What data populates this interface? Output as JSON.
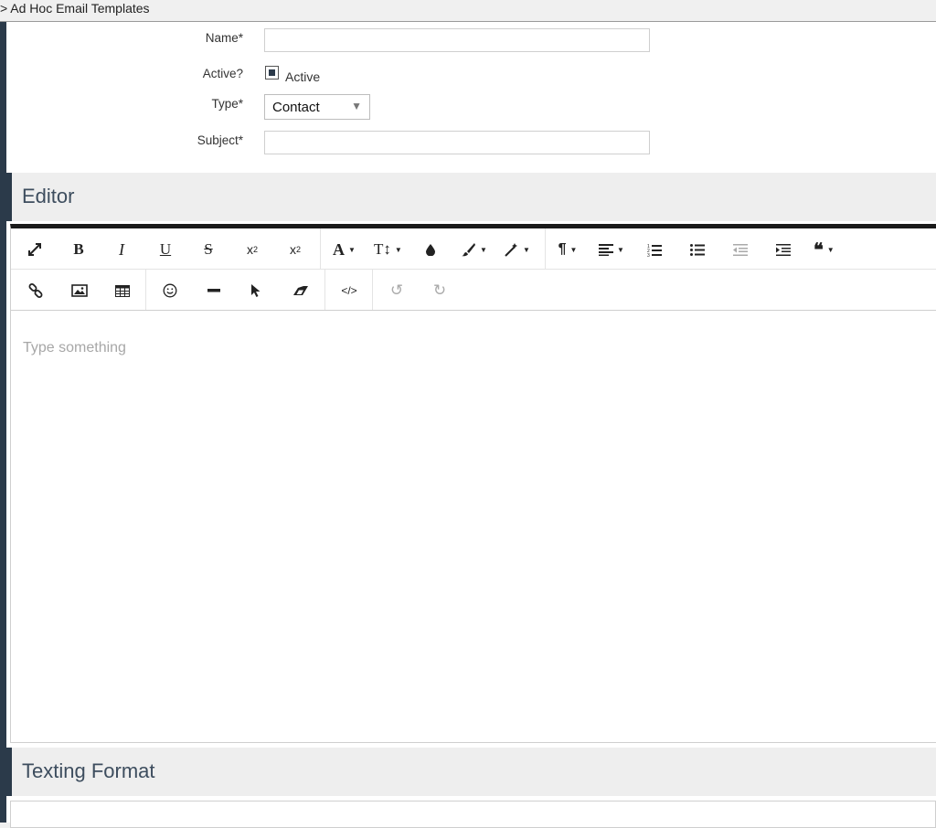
{
  "breadcrumb": {
    "text": "> Ad Hoc Email Templates"
  },
  "form": {
    "name_label": "Name*",
    "name_value": "",
    "active_label": "Active?",
    "active_option": "Active",
    "type_label": "Type*",
    "type_value": "Contact",
    "subject_label": "Subject*",
    "subject_value": ""
  },
  "sections": {
    "editor_title": "Editor",
    "texting_title": "Texting Format"
  },
  "editor": {
    "placeholder": "Type something",
    "toolbar_row1": [
      "fullscreen-icon",
      "bold-icon",
      "italic-icon",
      "underline-icon",
      "strikethrough-icon",
      "subscript-icon",
      "superscript-icon",
      "font-family-icon",
      "font-size-icon",
      "text-color-icon",
      "background-color-icon",
      "inline-style-icon",
      "paragraph-format-icon",
      "align-icon",
      "ordered-list-icon",
      "unordered-list-icon",
      "outdent-icon",
      "indent-icon",
      "quote-icon"
    ],
    "toolbar_row2": [
      "insert-link-icon",
      "insert-image-icon",
      "insert-table-icon",
      "emoticons-icon",
      "horizontal-line-icon",
      "select-all-icon",
      "clear-formatting-icon",
      "code-view-icon",
      "undo-icon",
      "redo-icon"
    ]
  },
  "colors": {
    "accent": "#2b3a4a",
    "header_bg": "#eeeeee",
    "placeholder": "#a7a7a7"
  }
}
